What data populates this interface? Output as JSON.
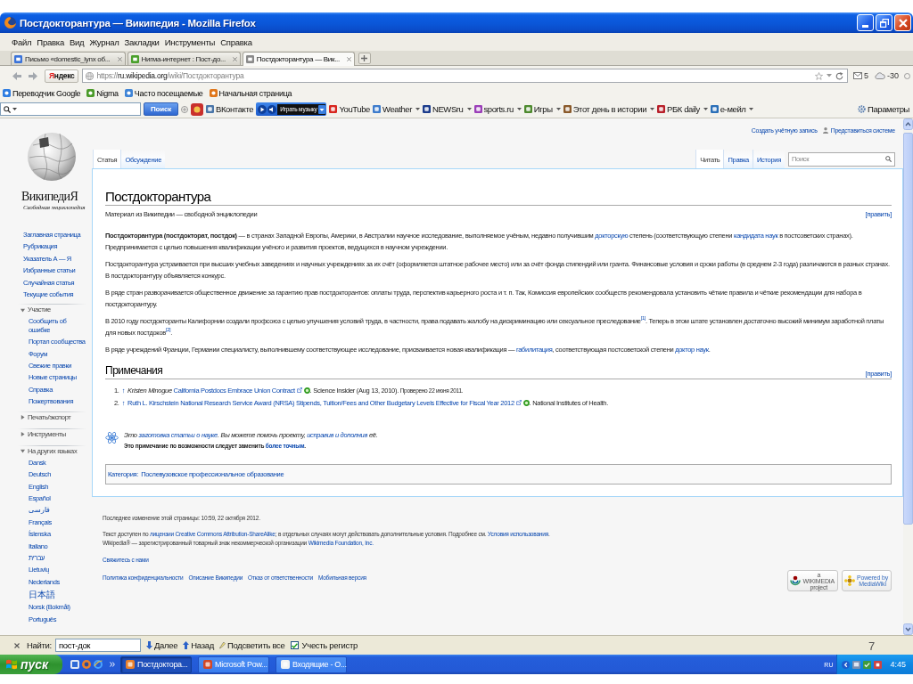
{
  "window": {
    "title": "Постдокторантура — Википедия - Mozilla Firefox"
  },
  "menu": [
    "Файл",
    "Правка",
    "Вид",
    "Журнал",
    "Закладки",
    "Инструменты",
    "Справка"
  ],
  "browser_tabs": [
    {
      "label": "Письмо «domestic_lynx об...",
      "selected": false
    },
    {
      "label": "Нигма-интернет : Пост-до...",
      "selected": false
    },
    {
      "label": "Постдокторантура — Вик...",
      "selected": true
    }
  ],
  "address_bar": {
    "search_engine": "Яндекс",
    "url": {
      "scheme": "https://",
      "host": "ru.wikipedia.org",
      "path": "/wiki/Постдокторантура"
    },
    "mail_count": "5",
    "temperature": "-30"
  },
  "bookmarks": [
    "Переводчик Google",
    "Nigma",
    "Часто посещаемые",
    "Начальная страница"
  ],
  "yandex_bar": {
    "search_button": "Поиск",
    "items": [
      {
        "kind": "site",
        "label": "ВКонтакте",
        "dropdown": false
      },
      {
        "kind": "player",
        "label": "Играть музыку",
        "dropdown": true
      },
      {
        "kind": "site",
        "label": "YouTube",
        "dropdown": false
      },
      {
        "kind": "site",
        "label": "Weather",
        "dropdown": true
      },
      {
        "kind": "site",
        "label": "NEWSru",
        "dropdown": true
      },
      {
        "kind": "site",
        "label": "sports.ru",
        "dropdown": true
      },
      {
        "kind": "site",
        "label": "Игры",
        "dropdown": true
      },
      {
        "kind": "site",
        "label": "Этот день в истории",
        "dropdown": true
      },
      {
        "kind": "site",
        "label": "РБК daily",
        "dropdown": true
      },
      {
        "kind": "site",
        "label": "e-мейл",
        "dropdown": true
      }
    ],
    "settings": "Параметры"
  },
  "sidebar": {
    "wordmark": "ВикипедиЯ",
    "tagline": "Свободная энциклопедия",
    "nav": [
      "Заглавная страница",
      "Рубрикация",
      "Указатель А — Я",
      "Избранные статьи",
      "Случайная статья",
      "Текущие события"
    ],
    "portals": [
      {
        "title": "Участие",
        "expanded": true,
        "items": [
          "Сообщить об ошибке",
          "Портал сообщества",
          "Форум",
          "Свежие правки",
          "Новые страницы",
          "Справка",
          "Пожертвования"
        ]
      },
      {
        "title": "Печать/экспорт",
        "expanded": false
      },
      {
        "title": "Инструменты",
        "expanded": false
      },
      {
        "title": "На других языках",
        "expanded": true,
        "items": [
          "Dansk",
          "Deutsch",
          "English",
          "Español",
          "فارسی",
          "Français",
          "Íslenska",
          "Italiano",
          "עברית",
          "Lietuvių",
          "Nederlands",
          "日本語",
          "Norsk (Bokmål)",
          "Português"
        ]
      }
    ]
  },
  "personal": {
    "create_account": "Создать учётную запись",
    "login": "Представиться системе"
  },
  "namespaces": [
    {
      "label": "Статья",
      "selected": true
    },
    {
      "label": "Обсуждение",
      "selected": false
    }
  ],
  "views": [
    {
      "label": "Читать",
      "selected": true
    },
    {
      "label": "Правка",
      "selected": false
    },
    {
      "label": "История",
      "selected": false
    }
  ],
  "search": {
    "placeholder": "Поиск"
  },
  "article": {
    "title": "Постдокторантура",
    "site_sub": "Материал из Википедии — свободной энциклопедии",
    "edit_link": "[править]",
    "paragraphs": [
      [
        {
          "kind": "bold",
          "text": "Постдокторантура (постдокторат, постдок)"
        },
        {
          "kind": "text",
          "text": " — в странах Западной Европы, Америки, в Австралии научное исследование, выполняемое учёным, недавно получившим "
        },
        {
          "kind": "link",
          "text": "докторскую"
        },
        {
          "kind": "text",
          "text": " степень (соответствующую степени "
        },
        {
          "kind": "link",
          "text": "кандидата наук"
        },
        {
          "kind": "text",
          "text": " в постсоветских странах). Предпринимается с целью повышения квалификации учёного и развития проектов, ведущихся в научном учреждении."
        }
      ],
      [
        {
          "kind": "text",
          "text": "Постдокторантура устраивается при высших учебных заведениях и научных учреждениях за их счёт (оформляется штатное рабочее место) или за счёт фонда стипендий или гранта. Финансовые условия и сроки работы (в среднем 2-3 года) различаются в разных странах. В постдокторантуру объявляется конкурс."
        }
      ],
      [
        {
          "kind": "text",
          "text": "В ряде стран разворачивается общественное движение за гарантию прав постдокторантов: оплаты труда, перспектив карьерного роста и т. п. Так, Комиссия европейских сообществ рекомендовала установить чёткие правила и чёткие рекомендации для набора в постдокторантуру."
        }
      ],
      [
        {
          "kind": "text",
          "text": "В 2010 году постдокторанты Калифорнии создали профсоюз с целью улучшения условий труда, в частности, права подавать жалобу на дискриминацию или сексуальное преследование"
        },
        {
          "kind": "ref",
          "text": "[1]"
        },
        {
          "kind": "text",
          "text": ". Теперь в этом штате установлен достаточно высокий минимум заработной платы для новых постдоков"
        },
        {
          "kind": "ref",
          "text": "[2]"
        },
        {
          "kind": "text",
          "text": "."
        }
      ],
      [
        {
          "kind": "text",
          "text": "В ряде учреждений Франции, Германии специалисту, выполнившему соответствующее исследование, присваивается новая квалификация — "
        },
        {
          "kind": "link",
          "text": "габилитация"
        },
        {
          "kind": "text",
          "text": ", соответствующая постсоветской степени "
        },
        {
          "kind": "link",
          "text": "доктор наук"
        },
        {
          "kind": "text",
          "text": "."
        }
      ]
    ],
    "notes": {
      "heading": "Примечания",
      "edit_link": "[править]",
      "references": [
        {
          "number": "1.",
          "backlink": "↑",
          "segments": [
            {
              "kind": "italic",
              "text": "Kristen Minogue "
            },
            {
              "kind": "extlink",
              "text": "California Postdocs Embrace Union Contract"
            },
            {
              "kind": "text",
              "text": ". Science Insider (Aug 13, 2010). "
            },
            {
              "kind": "small",
              "text": "Проверено 22 июня 2011."
            }
          ]
        },
        {
          "number": "2.",
          "backlink": "↑",
          "segments": [
            {
              "kind": "extlink",
              "text": "Ruth L. Kirschstein National Research Service Award (NRSA) Stipends, Tuition/Fees and Other Budgetary Levels Effective for Fiscal Year 2012"
            },
            {
              "kind": "text",
              "text": ". National Institutes of Health."
            }
          ]
        }
      ]
    },
    "stub": {
      "notice": [
        {
          "kind": "text",
          "text": "Это "
        },
        {
          "kind": "link",
          "text": "заготовка статьи о науке"
        },
        {
          "kind": "text",
          "text": ". Вы можете помочь проекту, "
        },
        {
          "kind": "link",
          "text": "исправив и дополнив"
        },
        {
          "kind": "text",
          "text": " её."
        }
      ],
      "note": [
        {
          "kind": "text",
          "text": "Это примечание по возможности следует заменить "
        },
        {
          "kind": "link",
          "text": "более точным"
        },
        {
          "kind": "text",
          "text": "."
        }
      ]
    },
    "categories": {
      "label": "Категория:",
      "links": [
        "Послевузовское профессиональное образование"
      ]
    }
  },
  "footer": {
    "last_modified": "Последнее изменение этой страницы: 10:59, 22 октября 2012.",
    "license": [
      {
        "kind": "text",
        "text": "Текст доступен по "
      },
      {
        "kind": "link",
        "text": "лицензии Creative Commons Attribution-ShareAlike"
      },
      {
        "kind": "text",
        "text": "; в отдельных случаях могут действовать дополнительные условия. Подробнее см. "
      },
      {
        "kind": "link",
        "text": "Условия использования"
      },
      {
        "kind": "text",
        "text": "."
      }
    ],
    "trademark": [
      {
        "kind": "text",
        "text": "Wikipedia® — зарегистрированный товарный знак некоммерческой организации "
      },
      {
        "kind": "link",
        "text": "Wikimedia Foundation, Inc."
      }
    ],
    "contact": "Свяжитесь с нами",
    "links": [
      "Политика конфиденциальности",
      "Описание Википедии",
      "Отказ от ответственности",
      "Мобильная версия"
    ],
    "badges": [
      {
        "kind": "wikimedia",
        "lines": [
          "a",
          "WIKIMEDIA",
          "project"
        ]
      },
      {
        "kind": "mediawiki",
        "lines": [
          "Powered by",
          "MediaWiki"
        ]
      }
    ]
  },
  "find_bar": {
    "label": "Найти:",
    "value": "пост-док",
    "next": "Далее",
    "previous": "Назад",
    "highlight": "Подсветить все",
    "match_case": {
      "label": "Учесть регистр",
      "checked": true
    }
  },
  "taskbar": {
    "start": "пуск",
    "tasks": [
      {
        "label": "Постдоктора...",
        "selected": true
      },
      {
        "label": "Microsoft Pow...",
        "selected": false
      },
      {
        "label": "Входящие - О...",
        "selected": false
      }
    ],
    "language": "RU",
    "clock": "4:45"
  },
  "stray_text": "7"
}
